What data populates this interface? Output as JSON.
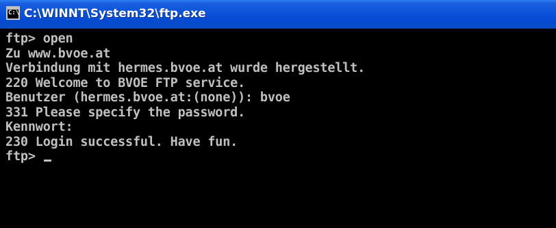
{
  "window": {
    "title": "C:\\WINNT\\System32\\ftp.exe",
    "icon": "console-icon",
    "icon_text": "C:\\"
  },
  "console": {
    "lines": [
      "ftp> open",
      "Zu www.bvoe.at",
      "Verbindung mit hermes.bvoe.at wurde hergestellt.",
      "220 Welcome to BVOE FTP service.",
      "Benutzer (hermes.bvoe.at:(none)): bvoe",
      "331 Please specify the password.",
      "Kennwort:",
      "230 Login successful. Have fun.",
      "ftp> "
    ]
  },
  "colors": {
    "background": "#000000",
    "foreground": "#c0c0c0",
    "titlebar": "#0a52d8"
  }
}
